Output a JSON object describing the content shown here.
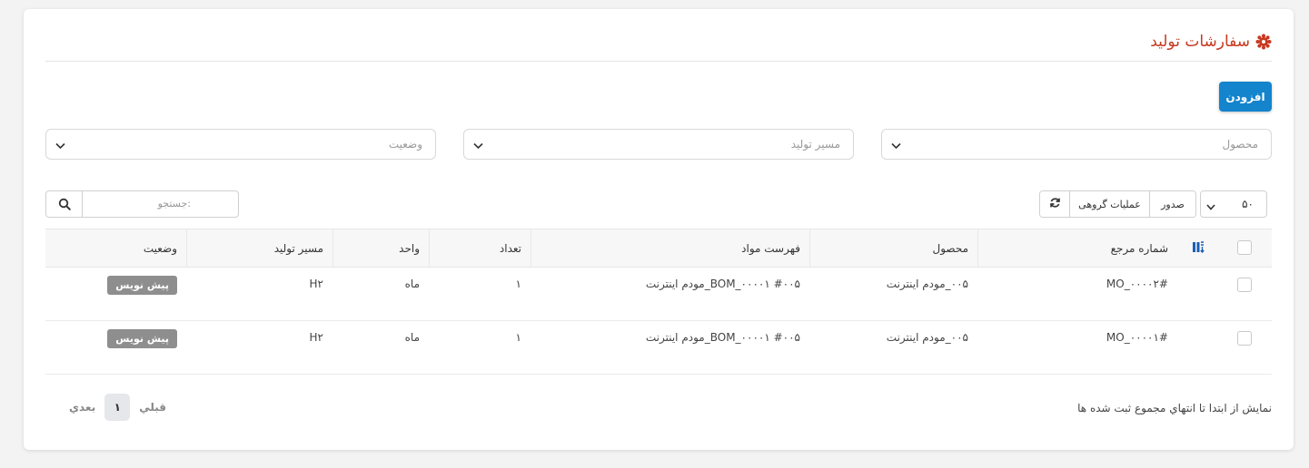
{
  "page": {
    "title": "سفارشات تولید",
    "title_icon": "gear-flower-icon",
    "accent_color": "#c8381f",
    "primary_color": "#1484cd"
  },
  "toolbar": {
    "add_label": "افزودن"
  },
  "filters": {
    "product_placeholder": "محصول",
    "route_placeholder": "مسیر تولید",
    "status_placeholder": "وضعیت"
  },
  "controls": {
    "page_size": "۵۰",
    "export_label": "صدور",
    "bulk_label": "عملیات گروهی",
    "refresh_icon": "refresh-icon",
    "search_placeholder": "جستجو:"
  },
  "table": {
    "columns": {
      "reference": "شماره مرجع",
      "product": "محصول",
      "bom": "فهرست مواد",
      "quantity": "تعداد",
      "unit": "واحد",
      "route": "مسیر تولید",
      "status": "وضعیت"
    },
    "rows": [
      {
        "reference": "MO_۰۰۰۰۲#",
        "product": "۰۰۵_مودم اینترنت",
        "bom": "#۰۰۵ BOM_۰۰۰۰۱_مودم اینترنت",
        "quantity": "۱",
        "unit": "ماه",
        "route": "H۲",
        "status": "پیش نویس"
      },
      {
        "reference": "MO_۰۰۰۰۱#",
        "product": "۰۰۵_مودم اینترنت",
        "bom": "#۰۰۵ BOM_۰۰۰۰۱_مودم اینترنت",
        "quantity": "۱",
        "unit": "ماه",
        "route": "H۲",
        "status": "پیش نویس"
      }
    ]
  },
  "footer": {
    "info": "نمايش از ابتدا تا انتهاي مجموع ثبت شده ها",
    "prev": "قبلي",
    "next": "بعدي",
    "current_page": "۱"
  }
}
